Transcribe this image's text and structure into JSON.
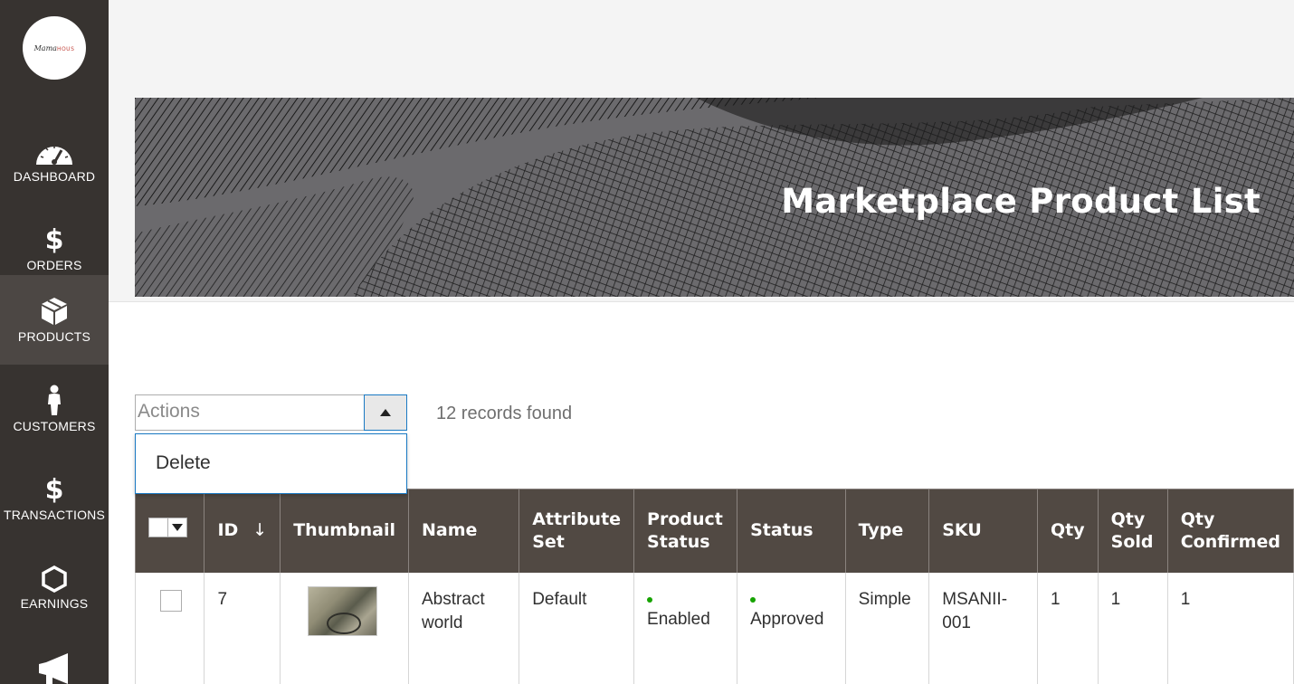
{
  "brand": {
    "logo_main": "Mama",
    "logo_accent": "HOUS"
  },
  "sidebar": {
    "items": [
      {
        "label": "DASHBOARD",
        "icon": "dashboard-gauge-icon"
      },
      {
        "label": "ORDERS",
        "icon": "dollar-icon"
      },
      {
        "label": "PRODUCTS",
        "icon": "box-icon",
        "active": true
      },
      {
        "label": "CUSTOMERS",
        "icon": "person-icon"
      },
      {
        "label": "TRANSACTIONS",
        "icon": "dollar-icon"
      },
      {
        "label": "EARNINGS",
        "icon": "hexagon-icon"
      }
    ],
    "dollar_glyph": "$"
  },
  "header": {
    "title": "Marketplace Product List"
  },
  "toolbar": {
    "actions_label": "Actions",
    "actions_menu": [
      "Delete"
    ],
    "records_found": "12 records found"
  },
  "grid": {
    "columns": [
      "ID",
      "Thumbnail",
      "Name",
      "Attribute Set",
      "Product Status",
      "Status",
      "Type",
      "SKU",
      "Qty",
      "Qty Sold",
      "Qty Confirmed"
    ],
    "column_lines": {
      "attribute_set": [
        "Attribute",
        "Set"
      ],
      "product_status": [
        "Product",
        "Status"
      ],
      "qty_sold": [
        "Qty",
        "Sold"
      ],
      "qty_confirmed": [
        "Qty",
        "Confirmed"
      ]
    },
    "sort_indicator": "↓",
    "rows": [
      {
        "id": "7",
        "name_lines": [
          "Abstract",
          "world"
        ],
        "attribute_set": "Default",
        "product_status": "Enabled",
        "status": "Approved",
        "type": "Simple",
        "sku_lines": [
          "MSANII-",
          "001"
        ],
        "qty": "1",
        "qty_sold": "1",
        "qty_confirmed": "1"
      }
    ]
  },
  "colors": {
    "sidebar_bg": "#373330",
    "sidebar_active": "#4c4744",
    "grid_header": "#514943",
    "status_dot": "#16a300",
    "focus_border": "#1979c3"
  }
}
